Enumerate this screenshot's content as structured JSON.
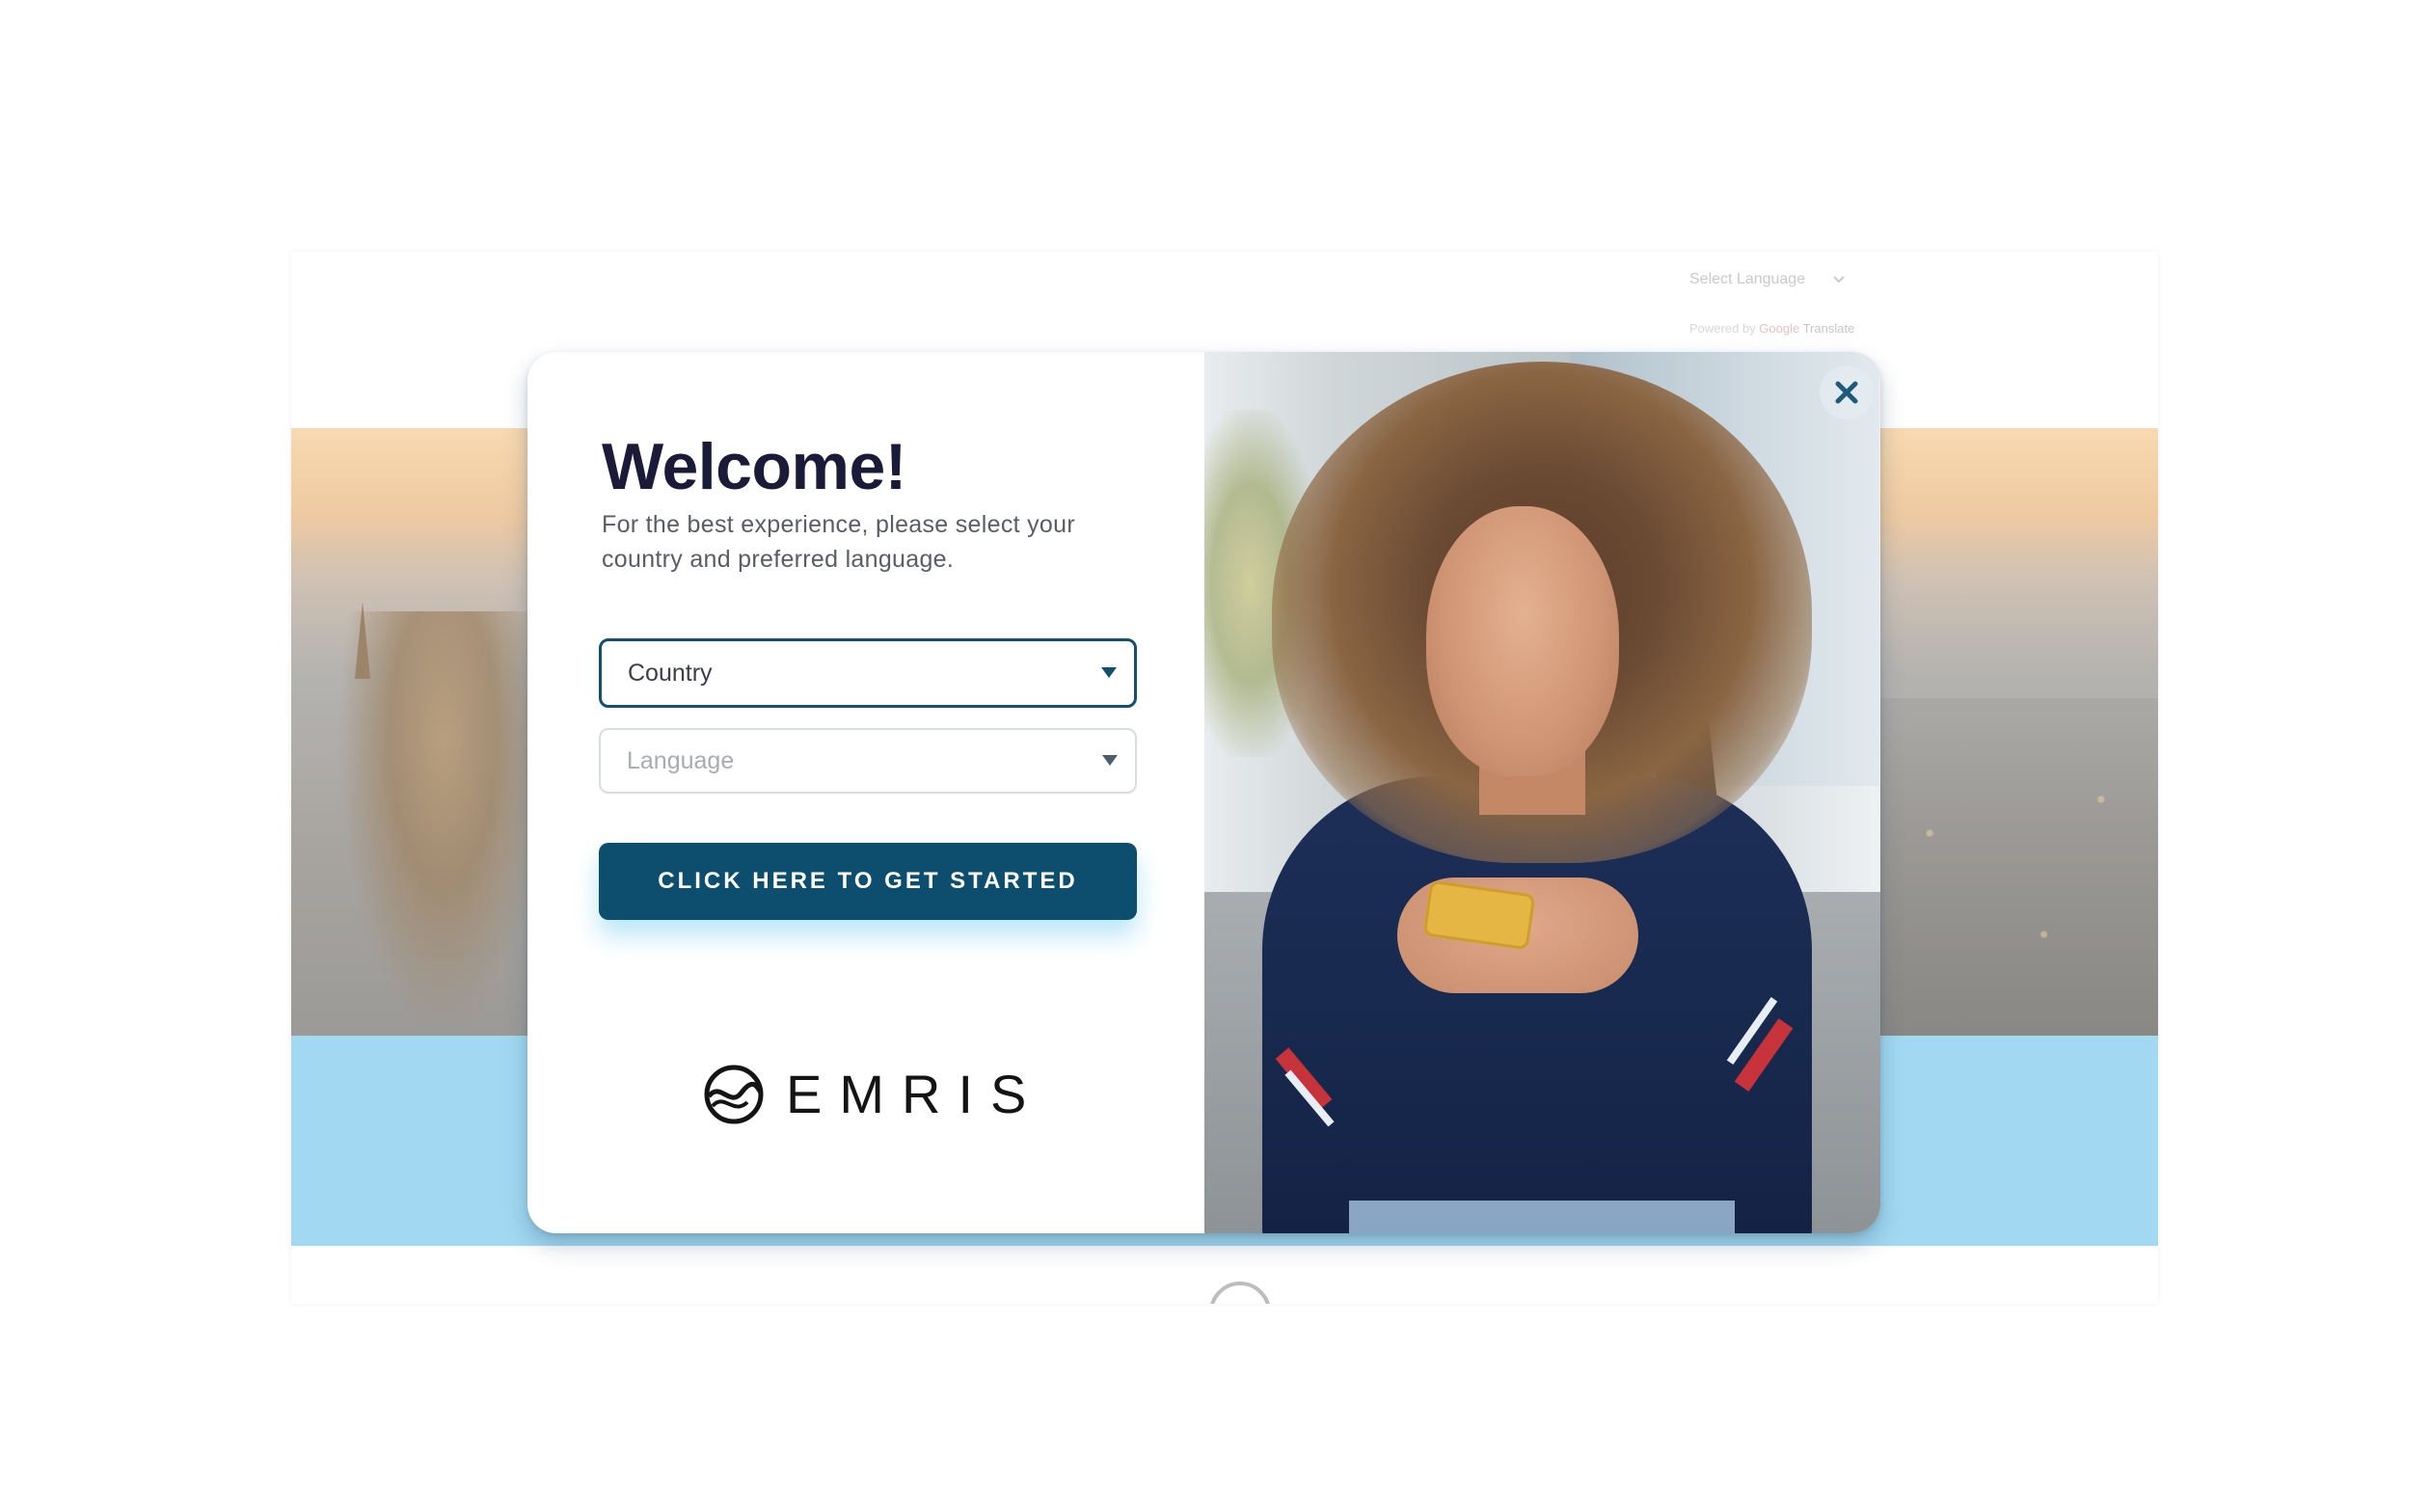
{
  "background": {
    "language_selector": {
      "label": "Select Language",
      "powered_by": "Powered by",
      "google": "Google",
      "translate": "Translate"
    },
    "band_color": "#a2d8f1"
  },
  "modal": {
    "title": "Welcome!",
    "subtitle": "For the best experience, please select your country and preferred language.",
    "country_select": {
      "placeholder": "Country"
    },
    "language_select": {
      "placeholder": "Language"
    },
    "cta_label": "CLICK HERE TO GET STARTED",
    "logo_text": "EMRIS",
    "close_icon": "close-icon",
    "colors": {
      "title": "#1a1b38",
      "button": "#0d4d6e",
      "border_active": "#134f6e"
    }
  }
}
